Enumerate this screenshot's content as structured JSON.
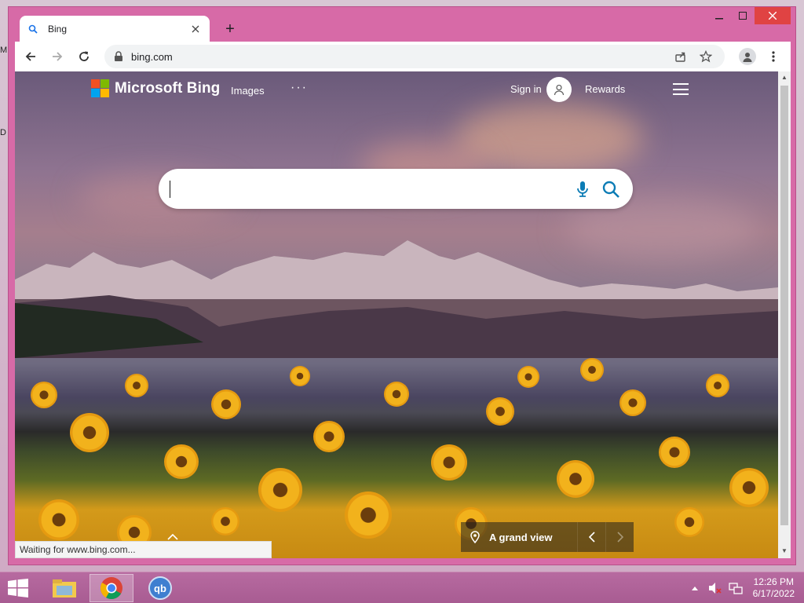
{
  "browser": {
    "tab_title": "Bing",
    "new_tab_symbol": "+",
    "url": "bing.com",
    "status_text": "Waiting for www.bing.com..."
  },
  "bing": {
    "brand": "Microsoft Bing",
    "nav_images": "Images",
    "nav_more": "···",
    "sign_in": "Sign in",
    "rewards": "Rewards",
    "search_placeholder": "",
    "image_caption": "A grand view"
  },
  "taskbar": {
    "time": "12:26 PM",
    "date": "6/17/2022",
    "apps": [
      "file-explorer",
      "chrome",
      "qbittorrent"
    ],
    "qb_label": "qb"
  },
  "desktop": {
    "edge_letters": [
      "M",
      "D"
    ]
  },
  "colors": {
    "window_frame": "#d76aa7",
    "close_button": "#e04343",
    "bing_accent": "#0c7cb5",
    "taskbar": "#b06596"
  }
}
